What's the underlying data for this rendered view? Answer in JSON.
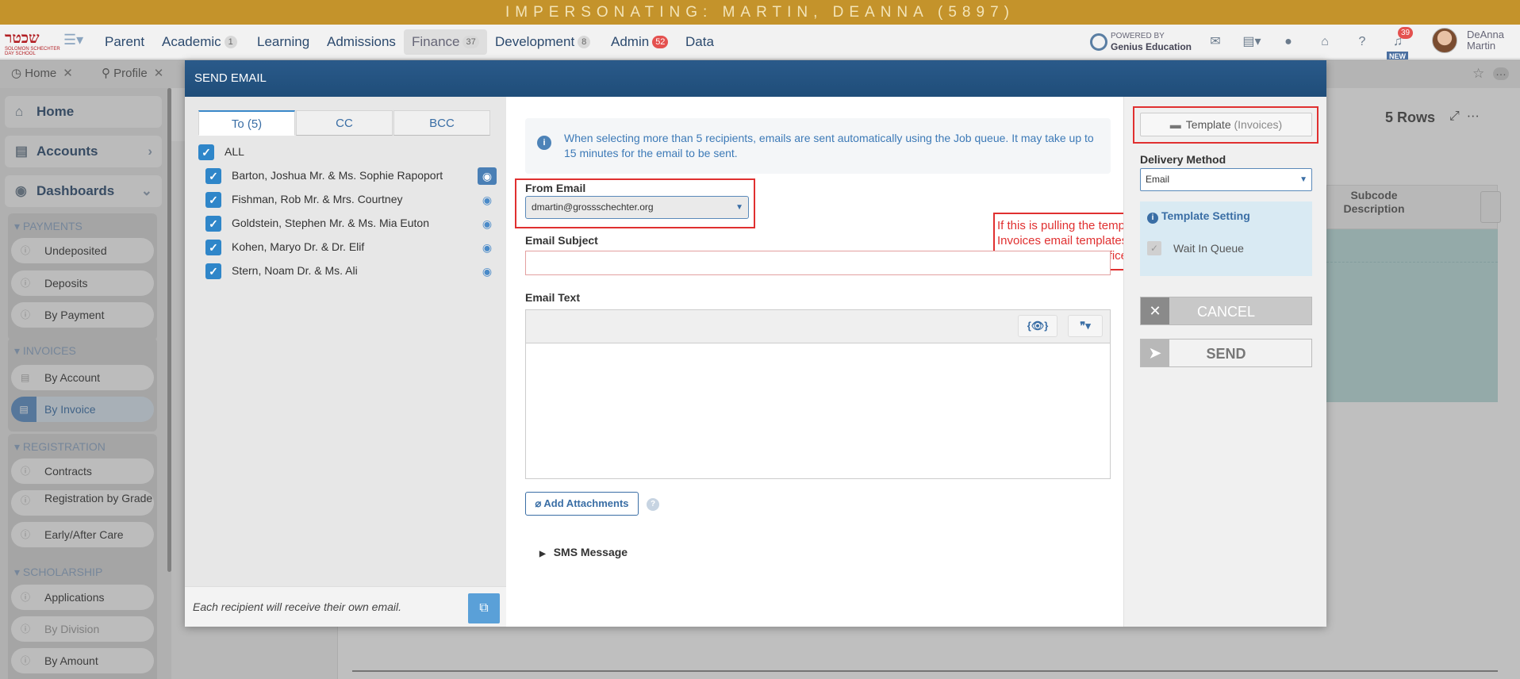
{
  "banner": {
    "text": "IMPERSONATING: MARTIN, DEANNA (5897)"
  },
  "logo": {
    "hebrew": "שכטר",
    "subtitle": "SOLOMON SCHECHTER DAY SCHOOL"
  },
  "nav": {
    "items": [
      {
        "label": "Parent",
        "count": ""
      },
      {
        "label": "Academic",
        "count": "1"
      },
      {
        "label": "Learning",
        "count": ""
      },
      {
        "label": "Admissions",
        "count": ""
      },
      {
        "label": "Finance",
        "count": "37"
      },
      {
        "label": "Development",
        "count": "8"
      },
      {
        "label": "Admin",
        "count": "52"
      },
      {
        "label": "Data",
        "count": ""
      }
    ],
    "powered_by": "POWERED BY",
    "powered_brand": "Genius Education",
    "notifications": "39",
    "new_badge": "NEW",
    "user_first": "DeAnna",
    "user_last": "Martin"
  },
  "tabs": [
    {
      "label": "Home"
    },
    {
      "label": "Profile"
    }
  ],
  "sidebar": {
    "top": [
      {
        "label": "Home"
      },
      {
        "label": "Accounts"
      },
      {
        "label": "Dashboards"
      }
    ],
    "groups": [
      {
        "title": "PAYMENTS",
        "items": [
          "Undeposited",
          "Deposits",
          "By Payment"
        ]
      },
      {
        "title": "INVOICES",
        "items": [
          "By Account",
          "By Invoice"
        ]
      },
      {
        "title": "REGISTRATION",
        "items": [
          "Contracts",
          "Registration by Grade",
          "Early/After Care"
        ]
      },
      {
        "title": "SCHOLARSHIP",
        "items": [
          "Applications",
          "By Division",
          "By Amount"
        ]
      }
    ]
  },
  "background": {
    "rows": "5 Rows",
    "subcode": "Subcode Description"
  },
  "modal": {
    "title": "SEND EMAIL",
    "recipient_tabs": [
      "To (5)",
      "CC",
      "BCC"
    ],
    "all_label": "ALL",
    "recipients": [
      "Barton, Joshua Mr. & Ms. Sophie Rapoport",
      "Fishman, Rob Mr. & Mrs. Courtney",
      "Goldstein, Stephen Mr. & Ms. Mia Euton",
      "Kohen, Maryo Dr. & Dr. Elif",
      "Stern, Noam Dr. & Ms. Ali"
    ],
    "footer_note": "Each recipient will receive their own email.",
    "info": "When selecting more than 5 recipients, emails are sent automatically using the Job queue. It may take up to 15 minutes for the email to be sent.",
    "from_label": "From Email",
    "from_value": "dmartin@grossschechter.org",
    "subject_label": "Email Subject",
    "subject_value": "",
    "text_label": "Email Text",
    "toolbar_preview": "{👁}",
    "toolbar_quote": "❞▾",
    "attach_label": "Add Attachments",
    "sms_label": "SMS Message",
    "annotation": "If this is pulling the template from the Invoices email templates than the sender should be businessoffice not dmartin.",
    "template_label": "Template",
    "template_sub": "(Invoices)",
    "delivery_label": "Delivery Method",
    "delivery_value": "Email",
    "template_setting": "Template Setting",
    "wait_in_queue": "Wait In Queue",
    "cancel_label": "CANCEL",
    "send_label": "SEND"
  }
}
